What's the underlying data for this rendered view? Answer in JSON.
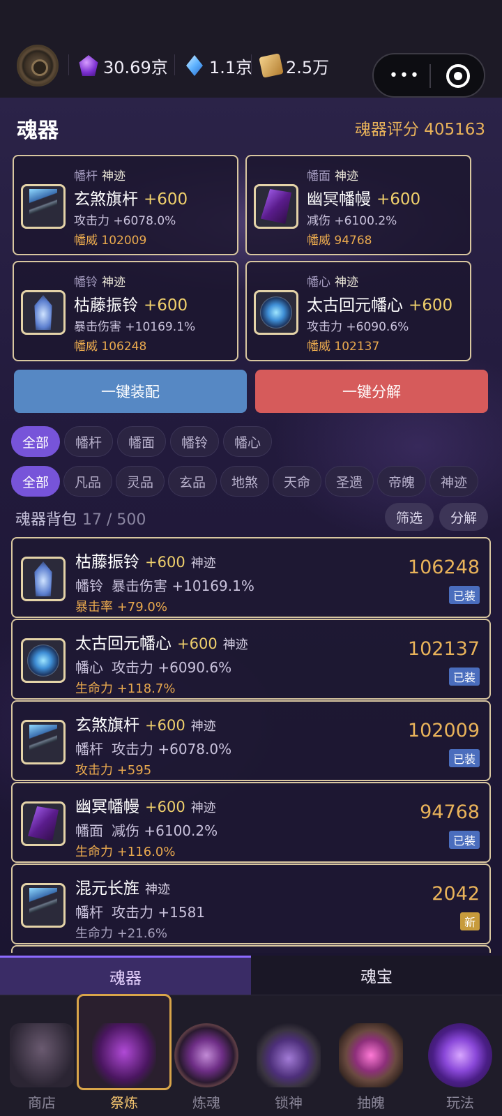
{
  "currency": [
    {
      "icon": "purple-gem-icon",
      "value": "30.69京"
    },
    {
      "icon": "blue-crystal-icon",
      "value": "1.1京"
    },
    {
      "icon": "scroll-icon",
      "value": "2.5万"
    }
  ],
  "header": {
    "title": "魂器",
    "score_label": "魂器评分 405163"
  },
  "slots": [
    {
      "category": "幡杆",
      "quality": "神迹",
      "name": "玄煞旗杆",
      "level": "+600",
      "stat": "攻击力 +6078.0%",
      "power": "幡威 102009",
      "icon": "staff-icon"
    },
    {
      "category": "幡面",
      "quality": "神迹",
      "name": "幽冥幡幔",
      "level": "+600",
      "stat": "减伤 +6100.2%",
      "power": "幡威 94768",
      "icon": "banner-icon"
    },
    {
      "category": "幡铃",
      "quality": "神迹",
      "name": "枯藤振铃",
      "level": "+600",
      "stat": "暴击伤害 +10169.1%",
      "power": "幡威 106248",
      "icon": "bell-icon"
    },
    {
      "category": "幡心",
      "quality": "神迹",
      "name": "太古回元幡心",
      "level": "+600",
      "stat": "攻击力 +6090.6%",
      "power": "幡威 102137",
      "icon": "orb-icon"
    }
  ],
  "actions": {
    "equip_all": "一键装配",
    "decompose_all": "一键分解"
  },
  "filters": {
    "types": [
      "全部",
      "幡杆",
      "幡面",
      "幡铃",
      "幡心"
    ],
    "grades": [
      "全部",
      "凡品",
      "灵品",
      "玄品",
      "地煞",
      "天命",
      "圣遗",
      "帝魄",
      "神迹"
    ],
    "active_type": 0,
    "active_grade": 0
  },
  "bag": {
    "title": "魂器背包",
    "count": "17 / 500",
    "filter_btn": "筛选",
    "decompose_btn": "分解"
  },
  "items": [
    {
      "name": "枯藤振铃",
      "level": "+600",
      "quality": "神迹",
      "slot": "幡铃",
      "main": "暴击伤害 +10169.1%",
      "sub": "暴击率 +79.0%",
      "value": "106248",
      "tag": "已装",
      "icon": "bell-icon"
    },
    {
      "name": "太古回元幡心",
      "level": "+600",
      "quality": "神迹",
      "slot": "幡心",
      "main": "攻击力 +6090.6%",
      "sub": "生命力 +118.7%",
      "value": "102137",
      "tag": "已装",
      "icon": "orb-icon"
    },
    {
      "name": "玄煞旗杆",
      "level": "+600",
      "quality": "神迹",
      "slot": "幡杆",
      "main": "攻击力 +6078.0%",
      "sub": "攻击力 +595",
      "value": "102009",
      "tag": "已装",
      "icon": "staff-icon"
    },
    {
      "name": "幽冥幡幔",
      "level": "+600",
      "quality": "神迹",
      "slot": "幡面",
      "main": "减伤 +6100.2%",
      "sub": "生命力 +116.0%",
      "value": "94768",
      "tag": "已装",
      "icon": "banner-icon"
    },
    {
      "name": "混元长旌",
      "level": "",
      "quality": "神迹",
      "slot": "幡杆",
      "main": "攻击力 +1581",
      "sub": "生命力 +21.6%",
      "value": "2042",
      "tag": "新",
      "icon": "staff-icon"
    }
  ],
  "tabs": [
    "魂器",
    "魂宝"
  ],
  "nav": [
    "商店",
    "祭炼",
    "炼魂",
    "锁神",
    "抽魄",
    "玩法"
  ]
}
